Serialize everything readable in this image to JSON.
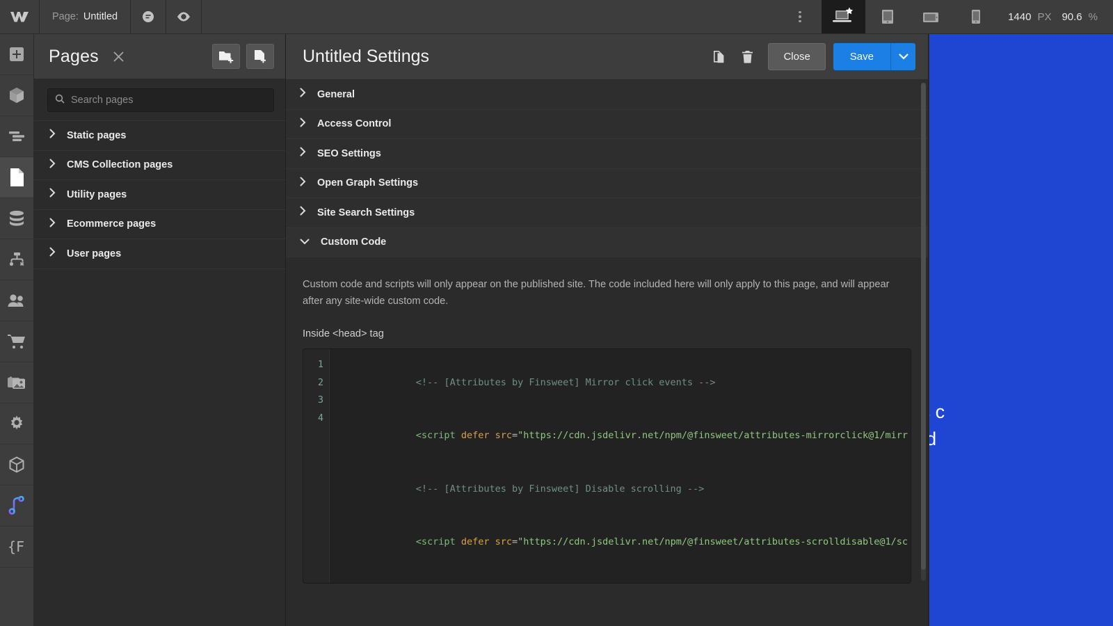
{
  "topbar": {
    "logo_icon": "webflow-logo-icon",
    "page_label": "Page:",
    "page_name": "Untitled",
    "comment_icon": "comment-bubble-icon",
    "preview_icon": "eye-preview-icon",
    "kebab_icon": "more-options-icon",
    "breakpoints": [
      {
        "name": "desktop-breakpoint",
        "icon": "desktop-star-icon",
        "active": true
      },
      {
        "name": "tablet-breakpoint",
        "icon": "tablet-icon",
        "active": false
      },
      {
        "name": "mobile-landscape-breakpoint",
        "icon": "mobile-landscape-icon",
        "active": false
      },
      {
        "name": "mobile-portrait-breakpoint",
        "icon": "mobile-portrait-icon",
        "active": false
      }
    ],
    "canvas_width": "1440",
    "canvas_width_unit": "PX",
    "zoom_value": "90.6",
    "zoom_unit": "%"
  },
  "rail": {
    "items": [
      {
        "name": "add-elements",
        "icon": "plus-square-icon",
        "active": false
      },
      {
        "name": "components",
        "icon": "cube-icon",
        "active": false
      },
      {
        "name": "navigator",
        "icon": "navigator-lines-icon",
        "active": false
      },
      {
        "name": "pages",
        "icon": "page-document-icon",
        "active": true
      },
      {
        "name": "cms",
        "icon": "database-icon",
        "active": false
      },
      {
        "name": "logic",
        "icon": "logic-flow-icon",
        "active": false
      },
      {
        "name": "users",
        "icon": "users-icon",
        "active": false
      },
      {
        "name": "ecommerce",
        "icon": "shopping-cart-icon",
        "active": false
      },
      {
        "name": "assets",
        "icon": "images-icon",
        "active": false
      },
      {
        "name": "settings",
        "icon": "gear-icon",
        "active": false
      },
      {
        "name": "apps",
        "icon": "cube-outline-icon",
        "active": false
      },
      {
        "name": "audio-app",
        "icon": "music-note-gradient-icon",
        "active": false
      },
      {
        "name": "finsweet-app",
        "icon": "finsweet-brace-f-icon",
        "active": false
      }
    ]
  },
  "pages_panel": {
    "title": "Pages",
    "close_icon": "close-x-icon",
    "new_folder_icon": "new-folder-plus-icon",
    "new_page_icon": "new-page-plus-icon",
    "search": {
      "placeholder": "Search pages",
      "value": "",
      "icon": "search-icon"
    },
    "groups": [
      {
        "label": "Static pages",
        "expanded": false
      },
      {
        "label": "CMS Collection pages",
        "expanded": false
      },
      {
        "label": "Utility pages",
        "expanded": false
      },
      {
        "label": "Ecommerce pages",
        "expanded": false
      },
      {
        "label": "User pages",
        "expanded": false
      }
    ]
  },
  "settings_modal": {
    "title": "Untitled Settings",
    "duplicate_icon": "duplicate-copy-icon",
    "delete_icon": "trash-can-icon",
    "close_label": "Close",
    "save_label": "Save",
    "save_caret_icon": "chevron-down-icon",
    "sections": [
      {
        "label": "General",
        "expanded": false
      },
      {
        "label": "Access Control",
        "expanded": false
      },
      {
        "label": "SEO Settings",
        "expanded": false
      },
      {
        "label": "Open Graph Settings",
        "expanded": false
      },
      {
        "label": "Site Search Settings",
        "expanded": false
      },
      {
        "label": "Custom Code",
        "expanded": true
      }
    ],
    "custom_code": {
      "description": "Custom code and scripts will only appear on the published site. The code included here will only apply to this page, and will appear after any site-wide custom code.",
      "head_label": "Inside <head> tag",
      "editor_lines": [
        {
          "num": "1",
          "type": "comment",
          "text": "<!-- [Attributes by Finsweet] Mirror click events -->"
        },
        {
          "num": "2",
          "type": "script",
          "tag_open": "<script",
          "attr1": "defer",
          "attr2": "src",
          "equals": "=",
          "url": "\"https://cdn.jsdelivr.net/npm/@finsweet/attributes-mirrorclick@1/mirr"
        },
        {
          "num": "3",
          "type": "comment",
          "text": "<!-- [Attributes by Finsweet] Disable scrolling -->"
        },
        {
          "num": "4",
          "type": "script",
          "tag_open": "<script",
          "attr1": "defer",
          "attr2": "src",
          "equals": "=",
          "url": "\"https://cdn.jsdelivr.net/npm/@finsweet/attributes-scrolldisable@1/sc"
        }
      ]
    }
  },
  "canvas": {
    "background_color": "#1f46d2",
    "text_line_1": "tum tristique. Duis c",
    "text_line_2": "h et justo cursus id"
  },
  "colors": {
    "accent_blue": "#1b7fe3",
    "canvas_blue": "#1f46d2",
    "panel_bg": "#2b2b2b",
    "chrome_bg": "#3d3d3d",
    "editor_bg": "#222222"
  }
}
